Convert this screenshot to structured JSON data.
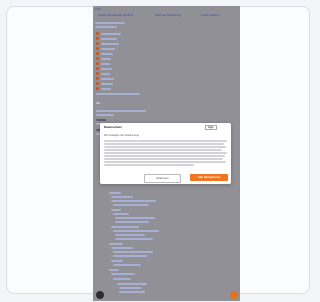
{
  "header": {
    "logo_text": "Tipp",
    "tabs": [
      "Gratis Versand ab 29,90 €",
      "Kauf auf Rechnung",
      "Gratis Hotline"
    ]
  },
  "cookie_dialog": {
    "title": "Datenschutz",
    "logo_text": "tipp",
    "subtitle": "Wir benötigen Ihre Zustimmung",
    "decline_label": "Ablehnen",
    "accept_label": "Alle akzeptieren"
  },
  "colors": {
    "accent": "#f27421",
    "page_bg": "#9a9aa0",
    "link": "#3b4fb0"
  }
}
